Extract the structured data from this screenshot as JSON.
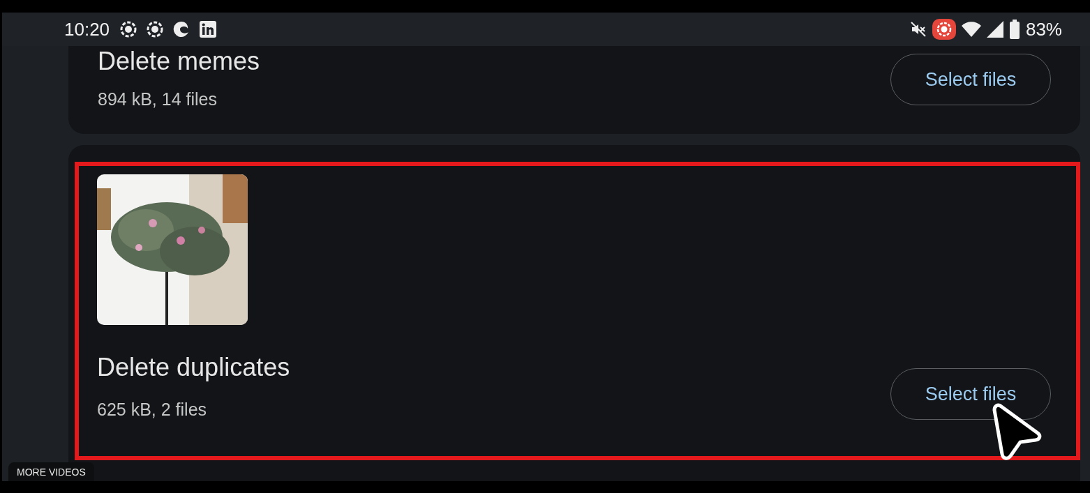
{
  "status_bar": {
    "time": "10:20",
    "battery": "83%"
  },
  "cards": [
    {
      "title": "Delete memes",
      "subtitle": "894 kB, 14 files",
      "button": "Select files",
      "highlighted": false
    },
    {
      "title": "Delete duplicates",
      "subtitle": "625 kB, 2 files",
      "button": "Select files",
      "highlighted": true
    }
  ],
  "overlay": {
    "label": "MORE VIDEOS"
  }
}
